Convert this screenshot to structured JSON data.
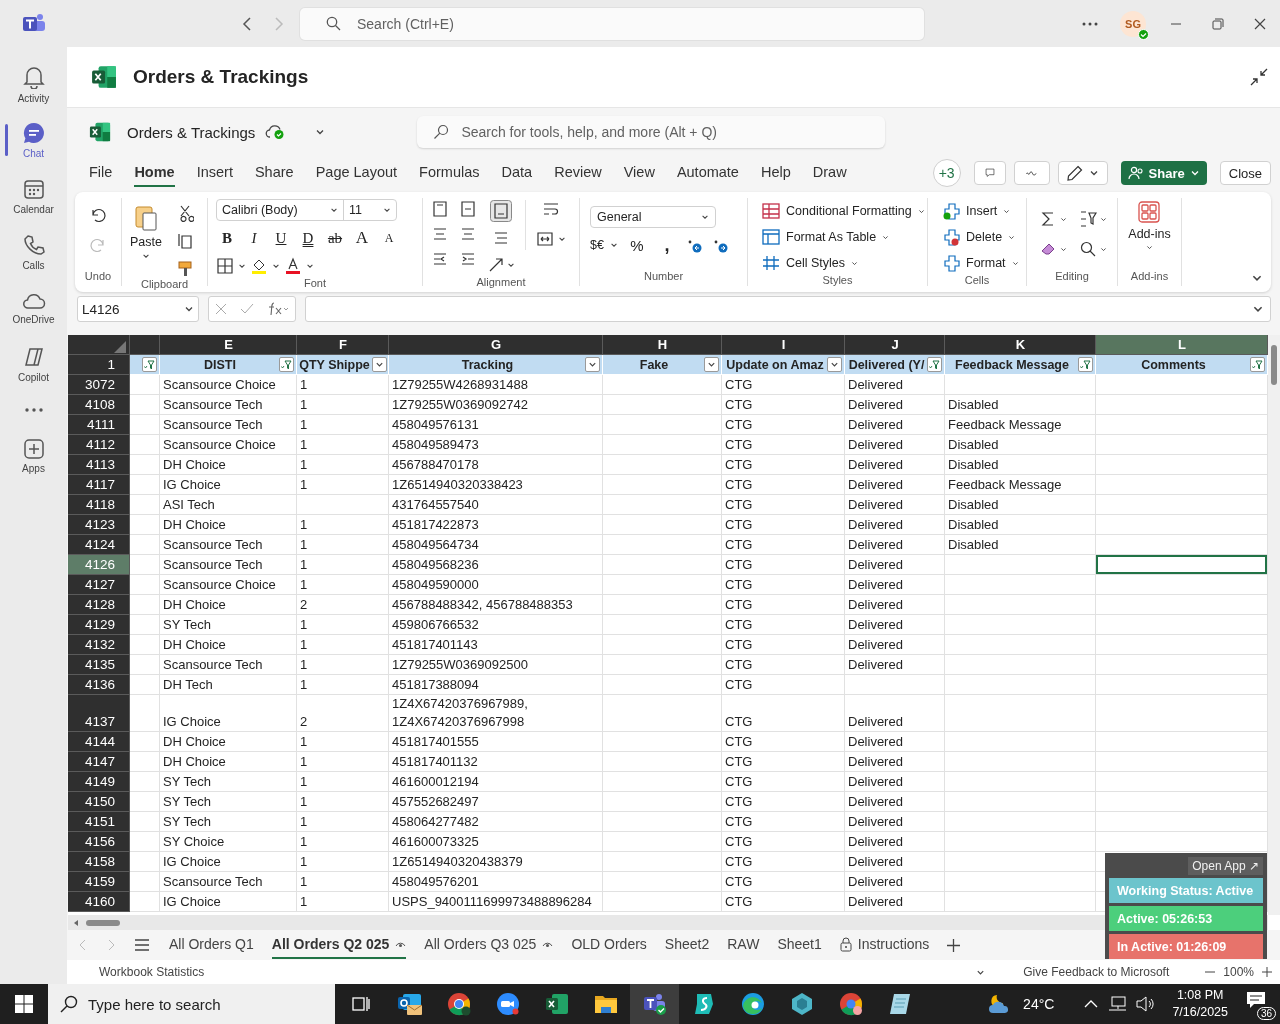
{
  "top_bar": {
    "search_placeholder": "Search (Ctrl+E)",
    "avatar": "SG"
  },
  "rail": [
    {
      "kind": "app",
      "label": "Activity",
      "selected": false
    },
    {
      "kind": "app",
      "label": "Chat",
      "selected": true
    },
    {
      "kind": "app",
      "label": "Calendar",
      "selected": false
    },
    {
      "kind": "app",
      "label": "Calls",
      "selected": false
    },
    {
      "kind": "app",
      "label": "OneDrive",
      "selected": false
    },
    {
      "kind": "app",
      "label": "Copilot",
      "selected": false
    },
    {
      "kind": "more",
      "selected": false
    },
    {
      "kind": "app",
      "label": "Apps",
      "selected": false
    }
  ],
  "header": {
    "title": "Orders & Trackings"
  },
  "workbook": {
    "name": "Orders & Trackings",
    "search_placeholder": "Search for tools, help, and more (Alt + Q)"
  },
  "menu": {
    "tabs": [
      {
        "label": "File",
        "selected": false
      },
      {
        "label": "Home",
        "selected": true
      },
      {
        "label": "Insert",
        "selected": false
      },
      {
        "label": "Share",
        "selected": false
      },
      {
        "label": "Page Layout",
        "selected": false
      },
      {
        "label": "Formulas",
        "selected": false
      },
      {
        "label": "Data",
        "selected": false
      },
      {
        "label": "Review",
        "selected": false
      },
      {
        "label": "View",
        "selected": false
      },
      {
        "label": "Automate",
        "selected": false
      },
      {
        "label": "Help",
        "selected": false
      },
      {
        "label": "Draw",
        "selected": false
      }
    ],
    "coauthors": "+3",
    "share": "Share",
    "close": "Close"
  },
  "ribbon": {
    "undo": {
      "label": "Undo"
    },
    "clipboard": {
      "label": "Clipboard",
      "paste": "Paste"
    },
    "font": {
      "label": "Font",
      "name": "Calibri (Body)",
      "size": "11",
      "buttons": [
        "B",
        "I",
        "U",
        "D",
        "ab",
        "A",
        "A"
      ]
    },
    "alignment": {
      "label": "Alignment"
    },
    "number": {
      "label": "Number",
      "format": "General",
      "currency": "$€",
      "percent": "%",
      "comma": ","
    },
    "styles": {
      "label": "Styles",
      "items": [
        "Conditional Formatting",
        "Format As Table",
        "Cell Styles"
      ]
    },
    "cells": {
      "label": "Cells",
      "items": [
        "Insert",
        "Delete",
        "Format"
      ]
    },
    "editing": {
      "label": "Editing"
    },
    "addins": {
      "label": "Add-ins",
      "button": "Add-ins"
    }
  },
  "formula_bar": {
    "name_box": "L4126"
  },
  "sheet": {
    "header_row": "1",
    "columns": [
      {
        "kind": "filtered",
        "selected": false
      },
      {
        "letter": "E",
        "header": "DISTI",
        "kind": "filtered",
        "selected": false
      },
      {
        "letter": "F",
        "header": "QTY Shippe",
        "kind": "dropdown",
        "selected": false
      },
      {
        "letter": "G",
        "header": "Tracking",
        "kind": "dropdown",
        "selected": false
      },
      {
        "letter": "H",
        "header": "Fake",
        "kind": "dropdown",
        "selected": false
      },
      {
        "letter": "I",
        "header": "Update on Amaz",
        "kind": "dropdown",
        "selected": false
      },
      {
        "letter": "J",
        "header": "Delivered (Y/",
        "kind": "filtered",
        "selected": false
      },
      {
        "letter": "K",
        "header": "Feedback Message",
        "kind": "filtered",
        "selected": false
      },
      {
        "letter": "L",
        "header": "Comments",
        "kind": "filtered",
        "selected": true
      }
    ],
    "rows": [
      {
        "number": "3072",
        "selected": false,
        "disti": "Scansource Choice",
        "qty_shipped": "1",
        "tracking": "1Z79255W4268931488",
        "update_on_amazon": "CTG",
        "delivered": "Delivered"
      },
      {
        "number": "4108",
        "selected": false,
        "disti": "Scansource Tech",
        "qty_shipped": "1",
        "tracking": "1Z79255W0369092742",
        "update_on_amazon": "CTG",
        "delivered": "Delivered",
        "feedback_message": "Disabled"
      },
      {
        "number": "4111",
        "selected": false,
        "disti": "Scansource Tech",
        "qty_shipped": "1",
        "tracking": "458049576131",
        "update_on_amazon": "CTG",
        "delivered": "Delivered",
        "feedback_message": "Feedback Message"
      },
      {
        "number": "4112",
        "selected": false,
        "disti": "Scansource Choice",
        "qty_shipped": "1",
        "tracking": "458049589473",
        "update_on_amazon": "CTG",
        "delivered": "Delivered",
        "feedback_message": "Disabled"
      },
      {
        "number": "4113",
        "selected": false,
        "disti": "DH Choice",
        "qty_shipped": "1",
        "tracking": "456788470178",
        "update_on_amazon": "CTG",
        "delivered": "Delivered",
        "feedback_message": "Disabled"
      },
      {
        "number": "4117",
        "selected": false,
        "disti": "IG Choice",
        "qty_shipped": "1",
        "tracking": "1Z6514940320338423",
        "update_on_amazon": "CTG",
        "delivered": "Delivered",
        "feedback_message": "Feedback Message"
      },
      {
        "number": "4118",
        "selected": false,
        "disti": "ASI Tech",
        "tracking": "431764557540",
        "update_on_amazon": "CTG",
        "delivered": "Delivered",
        "feedback_message": "Disabled"
      },
      {
        "number": "4123",
        "selected": false,
        "disti": "DH Choice",
        "qty_shipped": "1",
        "tracking": "451817422873",
        "update_on_amazon": "CTG",
        "delivered": "Delivered",
        "feedback_message": "Disabled"
      },
      {
        "number": "4124",
        "selected": false,
        "disti": "Scansource Tech",
        "qty_shipped": "1",
        "tracking": "458049564734",
        "update_on_amazon": "CTG",
        "delivered": "Delivered",
        "feedback_message": "Disabled"
      },
      {
        "number": "4126",
        "selected": true,
        "disti": "Scansource Tech",
        "qty_shipped": "1",
        "tracking": "458049568236",
        "update_on_amazon": "CTG",
        "delivered": "Delivered"
      },
      {
        "number": "4127",
        "selected": false,
        "disti": "Scansource Choice",
        "qty_shipped": "1",
        "tracking": "458049590000",
        "update_on_amazon": "CTG",
        "delivered": "Delivered"
      },
      {
        "number": "4128",
        "selected": false,
        "disti": "DH Choice",
        "qty_shipped": "2",
        "tracking": "456788488342, 456788488353",
        "update_on_amazon": "CTG",
        "delivered": "Delivered"
      },
      {
        "number": "4129",
        "selected": false,
        "disti": "SY Tech",
        "qty_shipped": "1",
        "tracking": "459806766532",
        "update_on_amazon": "CTG",
        "delivered": "Delivered"
      },
      {
        "number": "4132",
        "selected": false,
        "disti": "DH Choice",
        "qty_shipped": "1",
        "tracking": "451817401143",
        "update_on_amazon": "CTG",
        "delivered": "Delivered"
      },
      {
        "number": "4135",
        "selected": false,
        "disti": "Scansource Tech",
        "qty_shipped": "1",
        "tracking": "1Z79255W0369092500",
        "update_on_amazon": "CTG",
        "delivered": "Delivered"
      },
      {
        "number": "4136",
        "selected": false,
        "disti": "DH Tech",
        "qty_shipped": "1",
        "tracking": "451817388094",
        "update_on_amazon": "CTG"
      },
      {
        "number": "4137",
        "selected": false,
        "disti": "IG Choice",
        "qty_shipped": "2",
        "tracking": "1Z4X67420376967989, 1Z4X67420376967998",
        "update_on_amazon": "CTG",
        "delivered": "Delivered"
      },
      {
        "number": "4144",
        "selected": false,
        "disti": "DH Choice",
        "qty_shipped": "1",
        "tracking": "451817401555",
        "update_on_amazon": "CTG",
        "delivered": "Delivered"
      },
      {
        "number": "4147",
        "selected": false,
        "disti": "DH Choice",
        "qty_shipped": "1",
        "tracking": "451817401132",
        "update_on_amazon": "CTG",
        "delivered": "Delivered"
      },
      {
        "number": "4149",
        "selected": false,
        "disti": "SY Tech",
        "qty_shipped": "1",
        "tracking": "461600012194",
        "update_on_amazon": "CTG",
        "delivered": "Delivered"
      },
      {
        "number": "4150",
        "selected": false,
        "disti": "SY Tech",
        "qty_shipped": "1",
        "tracking": "457552682497",
        "update_on_amazon": "CTG",
        "delivered": "Delivered"
      },
      {
        "number": "4151",
        "selected": false,
        "disti": "SY Tech",
        "qty_shipped": "1",
        "tracking": "458064277482",
        "update_on_amazon": "CTG",
        "delivered": "Delivered"
      },
      {
        "number": "4156",
        "selected": false,
        "disti": "SY Choice",
        "qty_shipped": "1",
        "tracking": "461600073325",
        "update_on_amazon": "CTG",
        "delivered": "Delivered"
      },
      {
        "number": "4158",
        "selected": false,
        "disti": "IG Choice",
        "qty_shipped": "1",
        "tracking": "1Z6514940320438379",
        "update_on_amazon": "CTG",
        "delivered": "Delivered"
      },
      {
        "number": "4159",
        "selected": false,
        "disti": "Scansource Tech",
        "qty_shipped": "1",
        "tracking": "458049576201",
        "update_on_amazon": "CTG",
        "delivered": "Delivered"
      },
      {
        "number": "4160",
        "selected": false,
        "disti": "IG Choice",
        "qty_shipped": "1",
        "tracking": "USPS_9400111699973488896284",
        "update_on_amazon": "CTG",
        "delivered": "Delivered"
      }
    ]
  },
  "sheet_tabs": [
    {
      "label": "All Orders Q1",
      "kind": "plain",
      "selected": false
    },
    {
      "label": "All Orders Q2 025",
      "kind": "watched",
      "selected": true
    },
    {
      "label": "All Orders Q3 025",
      "kind": "watched",
      "selected": false
    },
    {
      "label": "OLD Orders",
      "kind": "plain",
      "selected": false
    },
    {
      "label": "Sheet2",
      "kind": "plain",
      "selected": false
    },
    {
      "label": "RAW",
      "kind": "plain",
      "selected": false
    },
    {
      "label": "Sheet1",
      "kind": "plain",
      "selected": false
    },
    {
      "label": "Instructions",
      "kind": "locked",
      "selected": false
    }
  ],
  "status_bar": {
    "statistics": "Workbook Statistics",
    "feedback": "Give Feedback to Microsoft",
    "zoom": "100%"
  },
  "status_widget": {
    "open_app": "Open App ↗",
    "items": [
      {
        "text": "Working Status: Active",
        "color": "#6cc4cc"
      },
      {
        "text": "Active: 05:26:53",
        "color": "#4ccf7c"
      },
      {
        "text": "In Active: 01:26:09",
        "color": "#e7736b"
      }
    ]
  },
  "taskbar": {
    "search_placeholder": "Type here to search",
    "apps": [
      {
        "selected": false
      },
      {
        "selected": false
      },
      {
        "selected": false
      },
      {
        "selected": false
      },
      {
        "selected": false
      },
      {
        "selected": true
      },
      {
        "selected": false
      },
      {
        "selected": false
      },
      {
        "selected": false
      },
      {
        "selected": false
      },
      {
        "selected": false
      }
    ],
    "temperature": "24°C",
    "time": "1:08 PM",
    "date": "7/16/2025",
    "notifications": "36"
  }
}
